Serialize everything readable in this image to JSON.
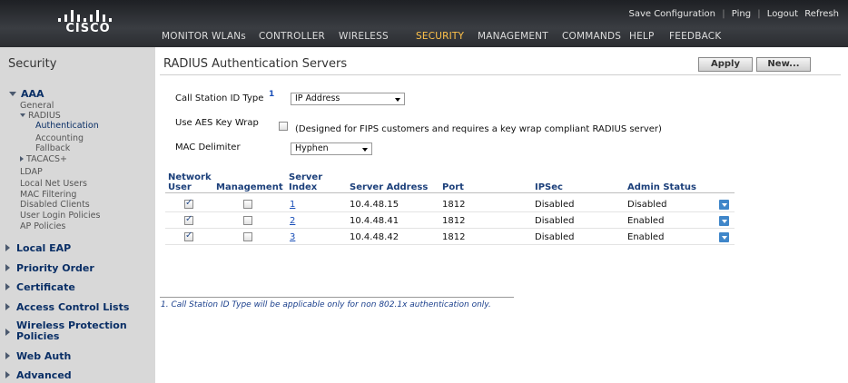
{
  "brand": {
    "name": "cisco"
  },
  "toplinks": {
    "save": "Save Configuration",
    "ping": "Ping",
    "logout": "Logout",
    "refresh": "Refresh"
  },
  "nav": {
    "items": [
      "MONITOR",
      "WLANs",
      "CONTROLLER",
      "WIRELESS",
      "SECURITY",
      "MANAGEMENT",
      "COMMANDS",
      "HELP",
      "FEEDBACK"
    ],
    "active": "SECURITY",
    "active_color": "#ffc24a"
  },
  "sidebar": {
    "title": "Security",
    "aaa": {
      "label": "AAA",
      "general": "General",
      "radius": "RADIUS",
      "radius_items": [
        "Authentication",
        "Accounting",
        "Fallback"
      ],
      "tacacs": "TACACS+",
      "others": [
        "LDAP",
        "Local Net Users",
        "MAC Filtering",
        "Disabled Clients",
        "User Login Policies",
        "AP Policies"
      ]
    },
    "sections": [
      "Local EAP",
      "Priority Order",
      "Certificate",
      "Access Control Lists",
      "Wireless Protection Policies",
      "Web Auth",
      "Advanced"
    ]
  },
  "page": {
    "title": "RADIUS Authentication Servers",
    "apply_label": "Apply",
    "new_label": "New..."
  },
  "form": {
    "call_station_label": "Call Station ID Type",
    "call_station_footnote_mark": "1",
    "call_station_value": "IP Address",
    "aes_label": "Use AES Key Wrap",
    "aes_checked": false,
    "aes_note": "(Designed for FIPS customers and requires a key wrap compliant RADIUS server)",
    "mac_label": "MAC Delimiter",
    "mac_value": "Hyphen"
  },
  "table": {
    "headers": {
      "network_user_1": "Network",
      "network_user_2": "User",
      "management": "Management",
      "server_index_1": "Server",
      "server_index_2": "Index",
      "server_address": "Server Address",
      "port": "Port",
      "ipsec": "IPSec",
      "admin_status": "Admin Status"
    },
    "rows": [
      {
        "network_user": true,
        "management": false,
        "index": "1",
        "address": "10.4.48.15",
        "port": "1812",
        "ipsec": "Disabled",
        "admin_status": "Disabled"
      },
      {
        "network_user": true,
        "management": false,
        "index": "2",
        "address": "10.4.48.41",
        "port": "1812",
        "ipsec": "Disabled",
        "admin_status": "Enabled"
      },
      {
        "network_user": true,
        "management": false,
        "index": "3",
        "address": "10.4.48.42",
        "port": "1812",
        "ipsec": "Disabled",
        "admin_status": "Enabled"
      }
    ]
  },
  "footnote": "1. Call Station ID Type will be applicable only for non 802.1x authentication only."
}
